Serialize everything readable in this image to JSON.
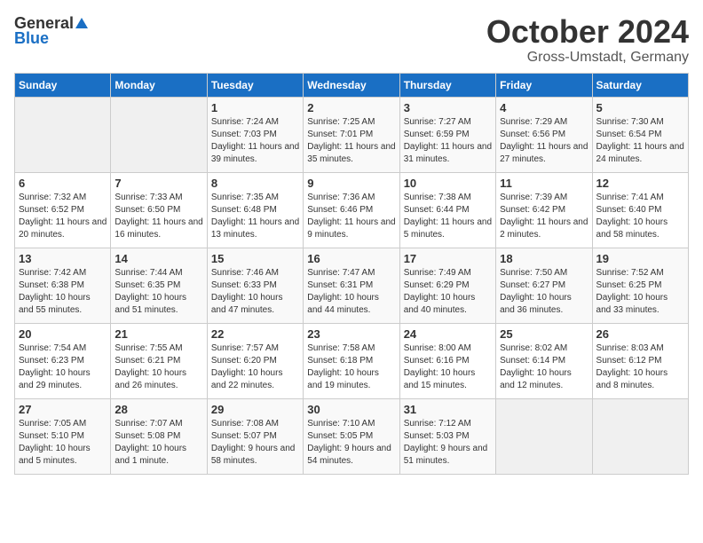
{
  "header": {
    "logo_general": "General",
    "logo_blue": "Blue",
    "month": "October 2024",
    "location": "Gross-Umstadt, Germany"
  },
  "days_of_week": [
    "Sunday",
    "Monday",
    "Tuesday",
    "Wednesday",
    "Thursday",
    "Friday",
    "Saturday"
  ],
  "weeks": [
    [
      {
        "day": "",
        "sunrise": "",
        "sunset": "",
        "daylight": "",
        "empty": true
      },
      {
        "day": "",
        "sunrise": "",
        "sunset": "",
        "daylight": "",
        "empty": true
      },
      {
        "day": "1",
        "sunrise": "Sunrise: 7:24 AM",
        "sunset": "Sunset: 7:03 PM",
        "daylight": "Daylight: 11 hours and 39 minutes.",
        "empty": false
      },
      {
        "day": "2",
        "sunrise": "Sunrise: 7:25 AM",
        "sunset": "Sunset: 7:01 PM",
        "daylight": "Daylight: 11 hours and 35 minutes.",
        "empty": false
      },
      {
        "day": "3",
        "sunrise": "Sunrise: 7:27 AM",
        "sunset": "Sunset: 6:59 PM",
        "daylight": "Daylight: 11 hours and 31 minutes.",
        "empty": false
      },
      {
        "day": "4",
        "sunrise": "Sunrise: 7:29 AM",
        "sunset": "Sunset: 6:56 PM",
        "daylight": "Daylight: 11 hours and 27 minutes.",
        "empty": false
      },
      {
        "day": "5",
        "sunrise": "Sunrise: 7:30 AM",
        "sunset": "Sunset: 6:54 PM",
        "daylight": "Daylight: 11 hours and 24 minutes.",
        "empty": false
      }
    ],
    [
      {
        "day": "6",
        "sunrise": "Sunrise: 7:32 AM",
        "sunset": "Sunset: 6:52 PM",
        "daylight": "Daylight: 11 hours and 20 minutes.",
        "empty": false
      },
      {
        "day": "7",
        "sunrise": "Sunrise: 7:33 AM",
        "sunset": "Sunset: 6:50 PM",
        "daylight": "Daylight: 11 hours and 16 minutes.",
        "empty": false
      },
      {
        "day": "8",
        "sunrise": "Sunrise: 7:35 AM",
        "sunset": "Sunset: 6:48 PM",
        "daylight": "Daylight: 11 hours and 13 minutes.",
        "empty": false
      },
      {
        "day": "9",
        "sunrise": "Sunrise: 7:36 AM",
        "sunset": "Sunset: 6:46 PM",
        "daylight": "Daylight: 11 hours and 9 minutes.",
        "empty": false
      },
      {
        "day": "10",
        "sunrise": "Sunrise: 7:38 AM",
        "sunset": "Sunset: 6:44 PM",
        "daylight": "Daylight: 11 hours and 5 minutes.",
        "empty": false
      },
      {
        "day": "11",
        "sunrise": "Sunrise: 7:39 AM",
        "sunset": "Sunset: 6:42 PM",
        "daylight": "Daylight: 11 hours and 2 minutes.",
        "empty": false
      },
      {
        "day": "12",
        "sunrise": "Sunrise: 7:41 AM",
        "sunset": "Sunset: 6:40 PM",
        "daylight": "Daylight: 10 hours and 58 minutes.",
        "empty": false
      }
    ],
    [
      {
        "day": "13",
        "sunrise": "Sunrise: 7:42 AM",
        "sunset": "Sunset: 6:38 PM",
        "daylight": "Daylight: 10 hours and 55 minutes.",
        "empty": false
      },
      {
        "day": "14",
        "sunrise": "Sunrise: 7:44 AM",
        "sunset": "Sunset: 6:35 PM",
        "daylight": "Daylight: 10 hours and 51 minutes.",
        "empty": false
      },
      {
        "day": "15",
        "sunrise": "Sunrise: 7:46 AM",
        "sunset": "Sunset: 6:33 PM",
        "daylight": "Daylight: 10 hours and 47 minutes.",
        "empty": false
      },
      {
        "day": "16",
        "sunrise": "Sunrise: 7:47 AM",
        "sunset": "Sunset: 6:31 PM",
        "daylight": "Daylight: 10 hours and 44 minutes.",
        "empty": false
      },
      {
        "day": "17",
        "sunrise": "Sunrise: 7:49 AM",
        "sunset": "Sunset: 6:29 PM",
        "daylight": "Daylight: 10 hours and 40 minutes.",
        "empty": false
      },
      {
        "day": "18",
        "sunrise": "Sunrise: 7:50 AM",
        "sunset": "Sunset: 6:27 PM",
        "daylight": "Daylight: 10 hours and 36 minutes.",
        "empty": false
      },
      {
        "day": "19",
        "sunrise": "Sunrise: 7:52 AM",
        "sunset": "Sunset: 6:25 PM",
        "daylight": "Daylight: 10 hours and 33 minutes.",
        "empty": false
      }
    ],
    [
      {
        "day": "20",
        "sunrise": "Sunrise: 7:54 AM",
        "sunset": "Sunset: 6:23 PM",
        "daylight": "Daylight: 10 hours and 29 minutes.",
        "empty": false
      },
      {
        "day": "21",
        "sunrise": "Sunrise: 7:55 AM",
        "sunset": "Sunset: 6:21 PM",
        "daylight": "Daylight: 10 hours and 26 minutes.",
        "empty": false
      },
      {
        "day": "22",
        "sunrise": "Sunrise: 7:57 AM",
        "sunset": "Sunset: 6:20 PM",
        "daylight": "Daylight: 10 hours and 22 minutes.",
        "empty": false
      },
      {
        "day": "23",
        "sunrise": "Sunrise: 7:58 AM",
        "sunset": "Sunset: 6:18 PM",
        "daylight": "Daylight: 10 hours and 19 minutes.",
        "empty": false
      },
      {
        "day": "24",
        "sunrise": "Sunrise: 8:00 AM",
        "sunset": "Sunset: 6:16 PM",
        "daylight": "Daylight: 10 hours and 15 minutes.",
        "empty": false
      },
      {
        "day": "25",
        "sunrise": "Sunrise: 8:02 AM",
        "sunset": "Sunset: 6:14 PM",
        "daylight": "Daylight: 10 hours and 12 minutes.",
        "empty": false
      },
      {
        "day": "26",
        "sunrise": "Sunrise: 8:03 AM",
        "sunset": "Sunset: 6:12 PM",
        "daylight": "Daylight: 10 hours and 8 minutes.",
        "empty": false
      }
    ],
    [
      {
        "day": "27",
        "sunrise": "Sunrise: 7:05 AM",
        "sunset": "Sunset: 5:10 PM",
        "daylight": "Daylight: 10 hours and 5 minutes.",
        "empty": false
      },
      {
        "day": "28",
        "sunrise": "Sunrise: 7:07 AM",
        "sunset": "Sunset: 5:08 PM",
        "daylight": "Daylight: 10 hours and 1 minute.",
        "empty": false
      },
      {
        "day": "29",
        "sunrise": "Sunrise: 7:08 AM",
        "sunset": "Sunset: 5:07 PM",
        "daylight": "Daylight: 9 hours and 58 minutes.",
        "empty": false
      },
      {
        "day": "30",
        "sunrise": "Sunrise: 7:10 AM",
        "sunset": "Sunset: 5:05 PM",
        "daylight": "Daylight: 9 hours and 54 minutes.",
        "empty": false
      },
      {
        "day": "31",
        "sunrise": "Sunrise: 7:12 AM",
        "sunset": "Sunset: 5:03 PM",
        "daylight": "Daylight: 9 hours and 51 minutes.",
        "empty": false
      },
      {
        "day": "",
        "sunrise": "",
        "sunset": "",
        "daylight": "",
        "empty": true
      },
      {
        "day": "",
        "sunrise": "",
        "sunset": "",
        "daylight": "",
        "empty": true
      }
    ]
  ]
}
